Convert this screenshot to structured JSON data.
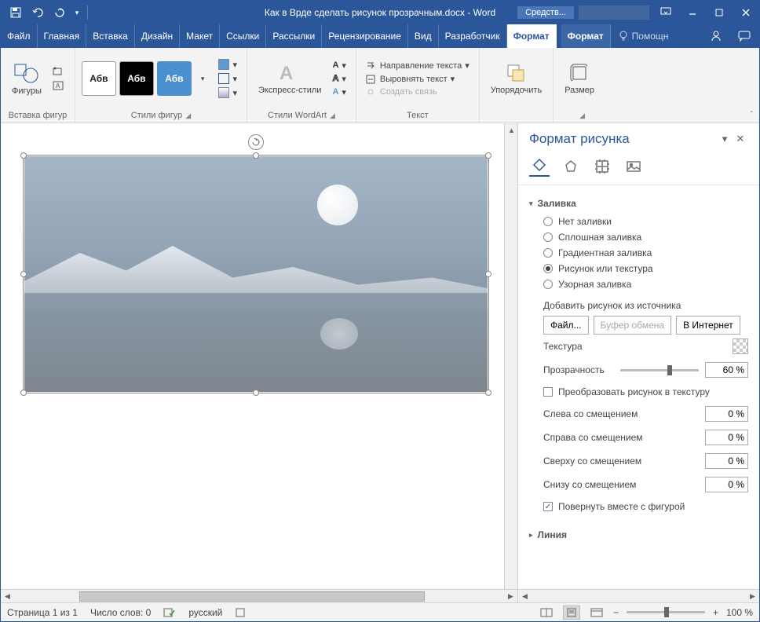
{
  "titlebar": {
    "document_title": "Как в Врде сделать рисунок прозрачным.docx - Word",
    "picture_tools": "Средств..."
  },
  "menu": {
    "file": "Файл",
    "home": "Главная",
    "insert": "Вставка",
    "design": "Дизайн",
    "layout": "Макет",
    "references": "Ссылки",
    "mailings": "Рассылки",
    "review": "Рецензирование",
    "view": "Вид",
    "developer": "Разработчик",
    "format": "Формат",
    "format2": "Формат",
    "tell_me": "Помощн"
  },
  "ribbon": {
    "shapes": "Фигуры",
    "insert_shapes": "Вставка фигур",
    "sample": "Абв",
    "shape_styles": "Стили фигур",
    "express_styles": "Экспресс-стили",
    "wordart_styles": "Стили WordArt",
    "text_direction": "Направление текста",
    "align_text": "Выровнять текст",
    "create_link": "Создать связь",
    "text": "Текст",
    "arrange": "Упорядочить",
    "size": "Размер"
  },
  "taskpane": {
    "title": "Формат рисунка",
    "fill_header": "Заливка",
    "no_fill": "Нет заливки",
    "solid_fill": "Сплошная заливка",
    "gradient_fill": "Градиентная заливка",
    "picture_fill": "Рисунок или текстура",
    "pattern_fill": "Узорная заливка",
    "insert_from": "Добавить рисунок из источника",
    "file_btn": "Файл...",
    "clipboard_btn": "Буфер обмена",
    "online_btn": "В Интернет",
    "texture": "Текстура",
    "transparency": "Прозрачность",
    "transparency_value": "60 %",
    "tile_as_texture": "Преобразовать рисунок в текстуру",
    "offset_left": "Слева со смещением",
    "offset_right": "Справа со смещением",
    "offset_top": "Сверху со смещением",
    "offset_bottom": "Снизу со смещением",
    "offset_value": "0 %",
    "rotate_with_shape": "Повернуть вместе с фигурой",
    "line_header": "Линия"
  },
  "statusbar": {
    "page": "Страница 1 из 1",
    "words": "Число слов: 0",
    "language": "русский",
    "zoom": "100 %"
  }
}
